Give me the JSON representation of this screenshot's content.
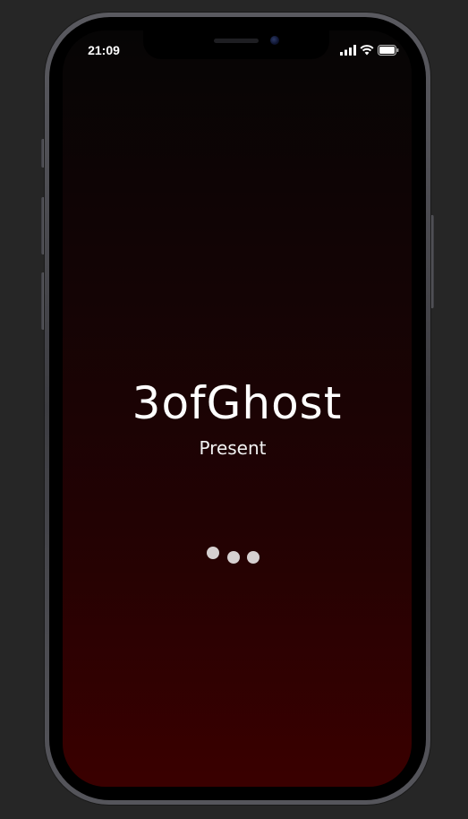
{
  "status_bar": {
    "time": "21:09",
    "icons": [
      "cellular-signal-icon",
      "wifi-icon",
      "battery-icon"
    ]
  },
  "splash": {
    "title": "3ofGhost",
    "subtitle": "Present",
    "loader_dots": 3
  },
  "colors": {
    "page_background": "#262626",
    "gradient_top": "#060505",
    "gradient_bottom": "#3a0000",
    "text": "#ffffff",
    "dot": "#d6d0d0"
  }
}
